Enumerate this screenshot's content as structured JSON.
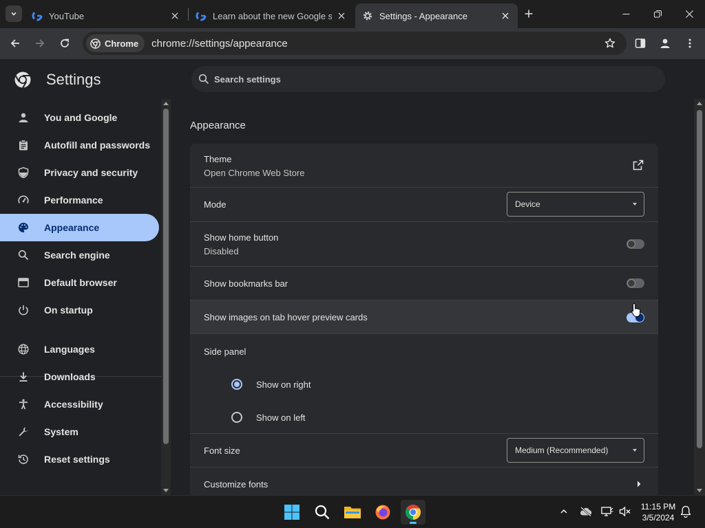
{
  "browser": {
    "tabs": [
      {
        "title": "YouTube",
        "active": false,
        "favicon": "google-g-icon"
      },
      {
        "title": "Learn about the new Google sign",
        "active": false,
        "favicon": "google-g-icon"
      },
      {
        "title": "Settings - Appearance",
        "active": true,
        "favicon": "gear-icon"
      }
    ],
    "chip_label": "Chrome",
    "url": "chrome://settings/appearance"
  },
  "settings": {
    "title": "Settings",
    "search_placeholder": "Search settings",
    "nav": [
      {
        "label": "You and Google",
        "icon": "person-icon"
      },
      {
        "label": "Autofill and passwords",
        "icon": "clipboard-icon"
      },
      {
        "label": "Privacy and security",
        "icon": "shield-icon"
      },
      {
        "label": "Performance",
        "icon": "speedometer-icon"
      },
      {
        "label": "Appearance",
        "icon": "palette-icon",
        "selected": true
      },
      {
        "label": "Search engine",
        "icon": "search-icon"
      },
      {
        "label": "Default browser",
        "icon": "browser-icon"
      },
      {
        "label": "On startup",
        "icon": "power-icon"
      },
      {
        "label": "Languages",
        "icon": "globe-icon"
      },
      {
        "label": "Downloads",
        "icon": "download-icon"
      },
      {
        "label": "Accessibility",
        "icon": "accessibility-icon"
      },
      {
        "label": "System",
        "icon": "wrench-icon"
      },
      {
        "label": "Reset settings",
        "icon": "reset-icon"
      }
    ],
    "section_title": "Appearance",
    "theme": {
      "label": "Theme",
      "sublabel": "Open Chrome Web Store"
    },
    "mode": {
      "label": "Mode",
      "value": "Device"
    },
    "home_button": {
      "label": "Show home button",
      "sublabel": "Disabled",
      "on": false
    },
    "bookmarks_bar": {
      "label": "Show bookmarks bar",
      "on": false
    },
    "hover_cards": {
      "label": "Show images on tab hover preview cards",
      "on": true
    },
    "side_panel": {
      "label": "Side panel",
      "options": [
        {
          "label": "Show on right",
          "checked": true
        },
        {
          "label": "Show on left",
          "checked": false
        }
      ]
    },
    "font_size": {
      "label": "Font size",
      "value": "Medium (Recommended)"
    },
    "customize_fonts": {
      "label": "Customize fonts"
    }
  },
  "taskbar": {
    "apps": [
      "windows-start-icon",
      "search-icon",
      "file-explorer-icon",
      "firefox-icon",
      "chrome-icon"
    ],
    "time": "11:15 PM",
    "date": "3/5/2024"
  },
  "colors": {
    "accent": "#a8c7fa",
    "accent_text": "#062e6f",
    "page_bg": "#202124",
    "card_bg": "#292a2d"
  }
}
